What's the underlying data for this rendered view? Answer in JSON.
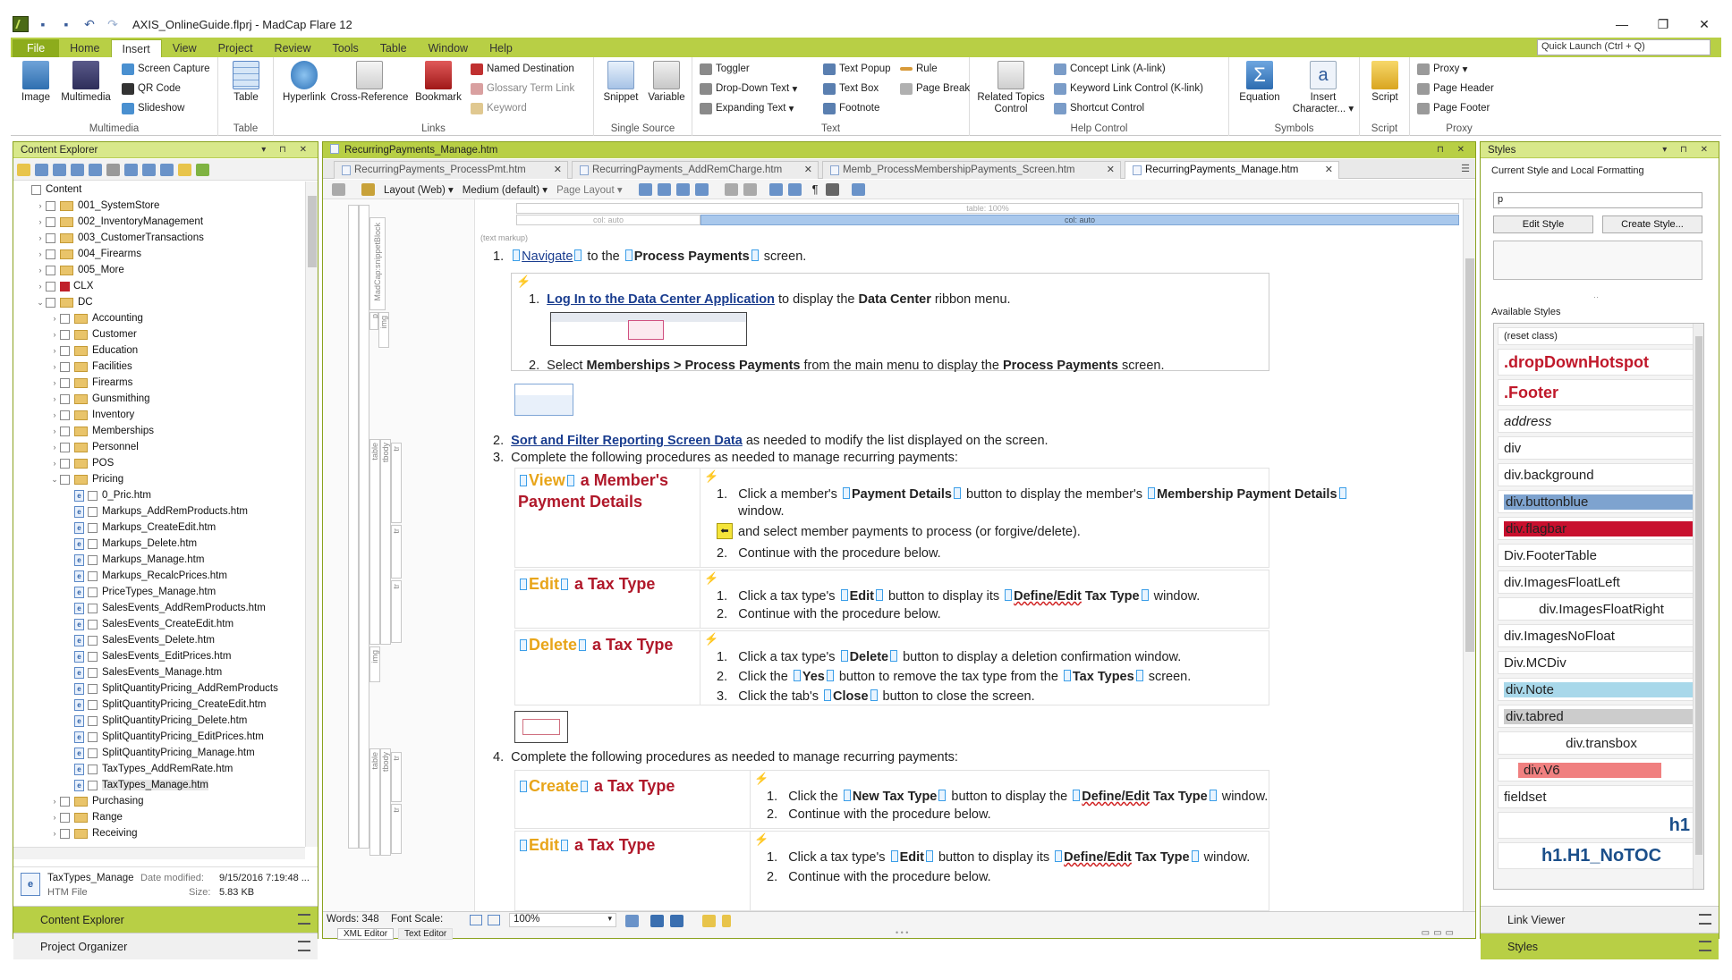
{
  "window": {
    "title": "AXIS_OnlineGuide.flprj - MadCap Flare 12",
    "controls": [
      "—",
      "❐",
      "✕"
    ]
  },
  "ribbon_tabs": [
    "File",
    "Home",
    "Insert",
    "View",
    "Project",
    "Review",
    "Tools",
    "Table",
    "Window",
    "Help"
  ],
  "active_tab": "Insert",
  "quick_launch": {
    "placeholder": "Quick Launch (Ctrl + Q)"
  },
  "ribbon": {
    "multimedia": {
      "label": "Multimedia",
      "image": "Image",
      "multimedia": "Multimedia",
      "screen_capture": "Screen Capture",
      "qr_code": "QR Code",
      "slideshow": "Slideshow"
    },
    "table": {
      "label": "Table",
      "table": "Table"
    },
    "links": {
      "label": "Links",
      "hyperlink": "Hyperlink",
      "cross_reference": "Cross-Reference",
      "bookmark": "Bookmark",
      "named_destination": "Named Destination",
      "glossary_term_link": "Glossary Term Link",
      "keyword": "Keyword"
    },
    "single_source": {
      "label": "Single Source",
      "snippet": "Snippet",
      "variable": "Variable"
    },
    "text": {
      "label": "Text",
      "toggler": "Toggler",
      "dropdown_text": "Drop-Down Text",
      "expanding_text": "Expanding Text",
      "text_popup": "Text Popup",
      "text_box": "Text Box",
      "footnote": "Footnote",
      "rule": "Rule",
      "page_break": "Page Break"
    },
    "help_control": {
      "label": "Help Control",
      "related_topics_1": "Related Topics",
      "related_topics_2": "Control",
      "concept_link": "Concept Link (A-link)",
      "keyword_link": "Keyword Link Control (K-link)",
      "shortcut_control": "Shortcut Control"
    },
    "symbols": {
      "label": "Symbols",
      "equation": "Equation",
      "insert_1": "Insert",
      "insert_2": "Character..."
    },
    "script": {
      "label": "Script",
      "script": "Script"
    },
    "proxy": {
      "label": "Proxy",
      "proxy": "Proxy",
      "page_header": "Page Header",
      "page_footer": "Page Footer"
    }
  },
  "content_explorer": {
    "title": "Content Explorer",
    "tree": [
      {
        "label": "Content",
        "level": 0,
        "type": "root",
        "exp": ""
      },
      {
        "label": "001_SystemStore",
        "level": 1,
        "type": "folder",
        "exp": "›"
      },
      {
        "label": "002_InventoryManagement",
        "level": 1,
        "type": "folder",
        "exp": "›"
      },
      {
        "label": "003_CustomerTransactions",
        "level": 1,
        "type": "folder",
        "exp": "›"
      },
      {
        "label": "004_Firearms",
        "level": 1,
        "type": "folder",
        "exp": "›"
      },
      {
        "label": "005_More",
        "level": 1,
        "type": "folder",
        "exp": "›"
      },
      {
        "label": "CLX",
        "level": 1,
        "type": "red",
        "exp": "›"
      },
      {
        "label": "DC",
        "level": 1,
        "type": "folder",
        "exp": "⌄"
      },
      {
        "label": "Accounting",
        "level": 2,
        "type": "folder",
        "exp": "›"
      },
      {
        "label": "Customer",
        "level": 2,
        "type": "folder",
        "exp": "›"
      },
      {
        "label": "Education",
        "level": 2,
        "type": "folder",
        "exp": "›"
      },
      {
        "label": "Facilities",
        "level": 2,
        "type": "folder",
        "exp": "›"
      },
      {
        "label": "Firearms",
        "level": 2,
        "type": "folder",
        "exp": "›"
      },
      {
        "label": "Gunsmithing",
        "level": 2,
        "type": "folder",
        "exp": "›"
      },
      {
        "label": "Inventory",
        "level": 2,
        "type": "folder",
        "exp": "›"
      },
      {
        "label": "Memberships",
        "level": 2,
        "type": "folder",
        "exp": "›"
      },
      {
        "label": "Personnel",
        "level": 2,
        "type": "folder",
        "exp": "›"
      },
      {
        "label": "POS",
        "level": 2,
        "type": "folder",
        "exp": "›"
      },
      {
        "label": "Pricing",
        "level": 2,
        "type": "folder",
        "exp": "⌄"
      },
      {
        "label": "0_Pric.htm",
        "level": 3,
        "type": "file",
        "exp": ""
      },
      {
        "label": "Markups_AddRemProducts.htm",
        "level": 3,
        "type": "file",
        "exp": ""
      },
      {
        "label": "Markups_CreateEdit.htm",
        "level": 3,
        "type": "file",
        "exp": ""
      },
      {
        "label": "Markups_Delete.htm",
        "level": 3,
        "type": "file",
        "exp": ""
      },
      {
        "label": "Markups_Manage.htm",
        "level": 3,
        "type": "file",
        "exp": ""
      },
      {
        "label": "Markups_RecalcPrices.htm",
        "level": 3,
        "type": "file",
        "exp": ""
      },
      {
        "label": "PriceTypes_Manage.htm",
        "level": 3,
        "type": "file",
        "exp": ""
      },
      {
        "label": "SalesEvents_AddRemProducts.htm",
        "level": 3,
        "type": "file",
        "exp": ""
      },
      {
        "label": "SalesEvents_CreateEdit.htm",
        "level": 3,
        "type": "file",
        "exp": ""
      },
      {
        "label": "SalesEvents_Delete.htm",
        "level": 3,
        "type": "file",
        "exp": ""
      },
      {
        "label": "SalesEvents_EditPrices.htm",
        "level": 3,
        "type": "file",
        "exp": ""
      },
      {
        "label": "SalesEvents_Manage.htm",
        "level": 3,
        "type": "file",
        "exp": ""
      },
      {
        "label": "SplitQuantityPricing_AddRemProducts",
        "level": 3,
        "type": "file",
        "exp": ""
      },
      {
        "label": "SplitQuantityPricing_CreateEdit.htm",
        "level": 3,
        "type": "file",
        "exp": ""
      },
      {
        "label": "SplitQuantityPricing_Delete.htm",
        "level": 3,
        "type": "file",
        "exp": ""
      },
      {
        "label": "SplitQuantityPricing_EditPrices.htm",
        "level": 3,
        "type": "file",
        "exp": ""
      },
      {
        "label": "SplitQuantityPricing_Manage.htm",
        "level": 3,
        "type": "file",
        "exp": ""
      },
      {
        "label": "TaxTypes_AddRemRate.htm",
        "level": 3,
        "type": "file",
        "exp": ""
      },
      {
        "label": "TaxTypes_Manage.htm",
        "level": 3,
        "type": "file",
        "exp": "",
        "selected": true
      },
      {
        "label": "Purchasing",
        "level": 2,
        "type": "folder",
        "exp": "›"
      },
      {
        "label": "Range",
        "level": 2,
        "type": "folder",
        "exp": "›"
      },
      {
        "label": "Receiving",
        "level": 2,
        "type": "folder",
        "exp": "›"
      }
    ],
    "file_info": {
      "name": "TaxTypes_Manage",
      "type": "HTM File",
      "date_label": "Date modified:",
      "date_value": "9/15/2016 7:19:48 ...",
      "size_label": "Size:",
      "size_value": "5.83 KB"
    },
    "bottom_tabs": [
      "Content Explorer",
      "Project Organizer"
    ]
  },
  "editor": {
    "active_file": "RecurringPayments_Manage.htm",
    "tabs": [
      "RecurringPayments_ProcessPmt.htm",
      "RecurringPayments_AddRemCharge.htm",
      "Memb_ProcessMembershipPayments_Screen.htm",
      "RecurringPayments_Manage.htm"
    ],
    "toolbar": {
      "layout": "Layout (Web)",
      "medium": "Medium (default)",
      "page_layout": "Page Layout"
    },
    "table_bar": {
      "table": "table: 100%",
      "col1": "col: auto",
      "col2": "col: auto"
    },
    "text_markup": "(text markup)",
    "content": {
      "s1_num": "1.",
      "s1_link": "Navigate",
      "s1_mid": " to the ",
      "s1_bold": "Process Payments",
      "s1_end": " screen.",
      "sub1_num": "1.",
      "sub1_link": "Log In to the Data Center Application",
      "sub1_mid": " to display the ",
      "sub1_bold": "Data Center",
      "sub1_end": " ribbon menu.",
      "sub2_num": "2.",
      "sub2_a": "Select ",
      "sub2_bold1": "Memberships > Process Payments",
      "sub2_mid": " from the main menu to display the ",
      "sub2_bold2": "Process Payments",
      "sub2_end": " screen.",
      "s2_num": "2.",
      "s2_link": "Sort and Filter Reporting Screen Data",
      "s2_end": " as needed to modify the list displayed on the screen.",
      "s3_num": "3.",
      "s3_text": "Complete the following procedures as needed to manage recurring payments:",
      "p1_t1": "View",
      "p1_t2": " a Member's",
      "p1_t3": "Payment Details",
      "p1_s1_num": "1.",
      "p1_s1_a": "Click a member's ",
      "p1_s1_b1": "Payment Details",
      "p1_s1_mid": " button to display the member's ",
      "p1_s1_b2": "Membership Payment Details",
      "p1_s1_c": "window.",
      "p1_s1_d": "and select member payments to process (or forgive/delete).",
      "p1_s2_num": "2.",
      "p1_s2": "Continue with the procedure below.",
      "p2_t1": "Edit",
      "p2_t2": " a Tax Type",
      "p2_s1_num": "1.",
      "p2_s1_a": "Click a tax type's ",
      "p2_s1_b1": "Edit",
      "p2_s1_mid": " button to display its ",
      "p2_s1_b2": "Define/Edit",
      "p2_s1_b3": " Tax Type",
      "p2_s1_end": " window.",
      "p2_s2_num": "2.",
      "p2_s2": "Continue with the procedure below.",
      "p3_t1": "Delete",
      "p3_t2": " a Tax Type",
      "p3_s1_num": "1.",
      "p3_s1_a": "Click a tax type's ",
      "p3_s1_b": "Delete",
      "p3_s1_end": " button to display a deletion confirmation window.",
      "p3_s2_num": "2.",
      "p3_s2_a": "Click the ",
      "p3_s2_b1": "Yes",
      "p3_s2_mid": " button to remove the tax type from the ",
      "p3_s2_b2": "Tax Types",
      "p3_s2_end": " screen.",
      "p3_s3_num": "3.",
      "p3_s3_a": "Click the tab's ",
      "p3_s3_b": "Close",
      "p3_s3_end": " button to close the screen.",
      "s4_num": "4.",
      "s4_text": "Complete the following procedures as needed to manage recurring payments:",
      "p4_t1": "Create",
      "p4_t2": " a Tax Type",
      "p4_s1_num": "1.",
      "p4_s1_a": "Click the ",
      "p4_s1_b1": "New Tax Type",
      "p4_s1_mid": " button to display the ",
      "p4_s1_b2": "Define/Edit",
      "p4_s1_b3": " Tax Type",
      "p4_s1_end": " window.",
      "p4_s2_num": "2.",
      "p4_s2": "Continue with the procedure below.",
      "p5_t1": "Edit",
      "p5_t2": " a Tax Type",
      "p5_s1_num": "1.",
      "p5_s1_a": "Click a tax type's ",
      "p5_s1_b1": "Edit",
      "p5_s1_mid": " button to display its ",
      "p5_s1_b2": "Define/Edit",
      "p5_s1_b3": " Tax Type",
      "p5_s1_end": " window.",
      "p5_s2_num": "2.",
      "p5_s2": "Continue with the procedure below."
    },
    "structure_labels": [
      "MadCap:snippetBlock",
      "p",
      "img",
      "table",
      "tbody",
      "tr",
      "tr",
      "tr",
      "img",
      "table",
      "tbody",
      "tr",
      "tr"
    ],
    "statusbar": {
      "words": "Words: 348",
      "font_scale": "Font Scale:",
      "zoom": "100%",
      "xml_editor": "XML Editor",
      "text_editor": "Text Editor"
    }
  },
  "styles": {
    "title": "Styles",
    "current_label": "Current Style and Local Formatting",
    "current_value": "p",
    "edit_style": "Edit Style",
    "create_style": "Create Style...",
    "available_label": "Available Styles",
    "items": [
      {
        "label": "(reset class)",
        "color": "#222222",
        "bg": "",
        "bold": false,
        "italic": false,
        "size": 11,
        "align": "left"
      },
      {
        "label": ".dropDownHotspot",
        "color": "#c0182a",
        "bg": "",
        "bold": true,
        "italic": false,
        "size": 18,
        "align": "left"
      },
      {
        "label": ".Footer",
        "color": "#c0182a",
        "bg": "",
        "bold": true,
        "italic": false,
        "size": 18,
        "align": "left"
      },
      {
        "label": "address",
        "color": "#222222",
        "bg": "",
        "bold": false,
        "italic": true,
        "size": 15,
        "align": "left"
      },
      {
        "label": "div",
        "color": "#222222",
        "bg": "",
        "bold": false,
        "italic": false,
        "size": 15,
        "align": "left"
      },
      {
        "label": "div.background",
        "color": "#222222",
        "bg": "",
        "bold": false,
        "italic": false,
        "size": 15,
        "align": "left"
      },
      {
        "label": "div.buttonblue",
        "color": "#222222",
        "bg": "#7ea3cf",
        "bold": false,
        "italic": false,
        "size": 15,
        "align": "left"
      },
      {
        "label": "div.flagbar",
        "color": "#222222",
        "bg": "#c8102e",
        "bold": false,
        "italic": false,
        "size": 15,
        "align": "left"
      },
      {
        "label": "Div.FooterTable",
        "color": "#222222",
        "bg": "",
        "bold": false,
        "italic": false,
        "size": 15,
        "align": "left"
      },
      {
        "label": "div.ImagesFloatLeft",
        "color": "#222222",
        "bg": "",
        "bold": false,
        "italic": false,
        "size": 15,
        "align": "left"
      },
      {
        "label": "div.ImagesFloatRight",
        "color": "#222222",
        "bg": "",
        "bold": false,
        "italic": false,
        "size": 15,
        "align": "center"
      },
      {
        "label": "div.ImagesNoFloat",
        "color": "#222222",
        "bg": "",
        "bold": false,
        "italic": false,
        "size": 15,
        "align": "left"
      },
      {
        "label": "Div.MCDiv",
        "color": "#222222",
        "bg": "",
        "bold": false,
        "italic": false,
        "size": 15,
        "align": "left"
      },
      {
        "label": "div.Note",
        "color": "#222222",
        "bg": "#a8d8ea",
        "bold": false,
        "italic": false,
        "size": 15,
        "align": "left"
      },
      {
        "label": "div.tabred",
        "color": "#222222",
        "bg": "#cccccc",
        "bold": false,
        "italic": false,
        "size": 15,
        "align": "left"
      },
      {
        "label": "div.transbox",
        "color": "#222222",
        "bg": "",
        "bold": false,
        "italic": false,
        "size": 15,
        "align": "center"
      },
      {
        "label": "div.V6",
        "color": "#222222",
        "bg": "#f08080",
        "bold": false,
        "italic": false,
        "size": 15,
        "align": "center-box"
      },
      {
        "label": "fieldset",
        "color": "#222222",
        "bg": "",
        "bold": false,
        "italic": false,
        "size": 15,
        "align": "left"
      },
      {
        "label": "h1",
        "color": "#1b4f8a",
        "bg": "",
        "bold": true,
        "italic": false,
        "size": 20,
        "align": "right"
      },
      {
        "label": "h1.H1_NoTOC",
        "color": "#1b4f8a",
        "bg": "",
        "bold": true,
        "italic": false,
        "size": 20,
        "align": "center"
      }
    ],
    "bottom_tabs": [
      "Link Viewer",
      "Styles"
    ]
  }
}
